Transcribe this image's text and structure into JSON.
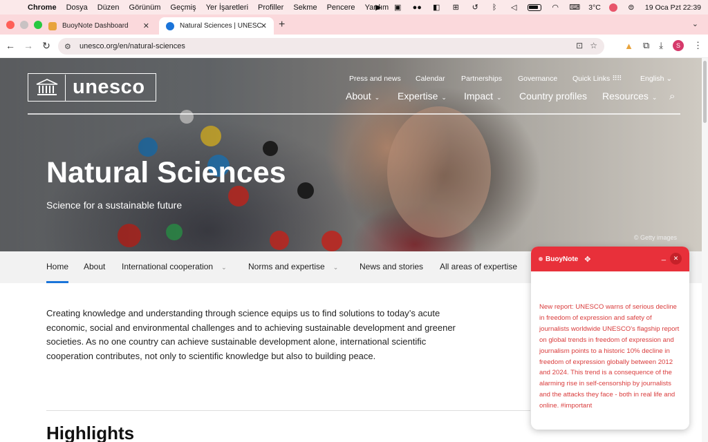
{
  "menubar": {
    "app": "Chrome",
    "items": [
      "Dosya",
      "Düzen",
      "Görünüm",
      "Geçmiş",
      "Yer İşaretleri",
      "Profiller",
      "Sekme",
      "Pencere",
      "Yardım"
    ],
    "weather": "3°C",
    "datetime": "19 Oca Pzt  22:39"
  },
  "tabs": [
    {
      "title": "BuoyNote Dashboard",
      "active": false
    },
    {
      "title": "Natural Sciences | UNESCO",
      "active": true
    }
  ],
  "address": {
    "url": "unesco.org/en/natural-sciences"
  },
  "profile": {
    "initial": "S"
  },
  "site": {
    "logo_text": "unesco",
    "top_links": [
      "Press and news",
      "Calendar",
      "Partnerships",
      "Governance",
      "Quick Links"
    ],
    "language": "English",
    "main_nav": [
      "About",
      "Expertise",
      "Impact",
      "Country profiles",
      "Resources"
    ],
    "hero_title": "Natural Sciences",
    "hero_subtitle": "Science for a sustainable future",
    "hero_credit": "© Getty images",
    "subnav": [
      "Home",
      "About",
      "International cooperation",
      "Norms and expertise",
      "News and stories",
      "All areas of expertise"
    ],
    "intro": "Creating knowledge and understanding through science equips us to find solutions to today’s acute economic, social and environmental challenges and to achieving sustainable development and greener societies. As no one country can achieve sustainable development alone, international scientific cooperation contributes, not only to scientific knowledge but also to building peace.",
    "section_title": "Highlights"
  },
  "buoynote": {
    "title": "BuoyNote",
    "minimize": "_",
    "note": "New report: UNESCO warns of serious decline in freedom of expression and safety of journalists worldwide UNESCO's flagship report on global trends in freedom of expression and journalism points to a historic 10% decline in freedom of expression globally between 2012 and 2024. This trend is a consequence of the alarming rise in self-censorship by journalists and the attacks they face - both in real life and online. #important"
  }
}
